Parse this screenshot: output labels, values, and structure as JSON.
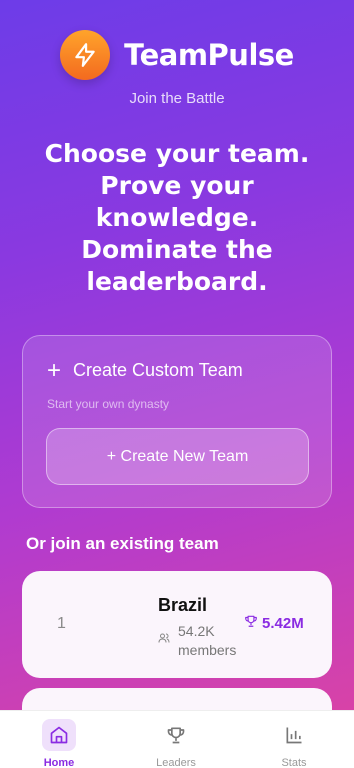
{
  "app": {
    "title": "TeamPulse",
    "tagline": "Join the Battle",
    "logo_icon": "lightning-bolt-icon",
    "accent": "#8a2be2"
  },
  "hero": {
    "lines": [
      "Choose your team.",
      "Prove your",
      "knowledge.",
      "Dominate the",
      "leaderboard."
    ]
  },
  "custom_team": {
    "title": "Create Custom Team",
    "subtitle": "Start your own dynasty",
    "button_label": "+ Create New Team"
  },
  "join_label": "Or join an existing team",
  "teams": [
    {
      "rank": "1",
      "name": "Brazil",
      "members_count": "54.2K",
      "members_word": "members",
      "score": "5.42M"
    }
  ],
  "nav": [
    {
      "label": "Home",
      "icon": "home-icon",
      "active": true
    },
    {
      "label": "Leaders",
      "icon": "trophy-icon",
      "active": false
    },
    {
      "label": "Stats",
      "icon": "bar-chart-icon",
      "active": false
    }
  ]
}
